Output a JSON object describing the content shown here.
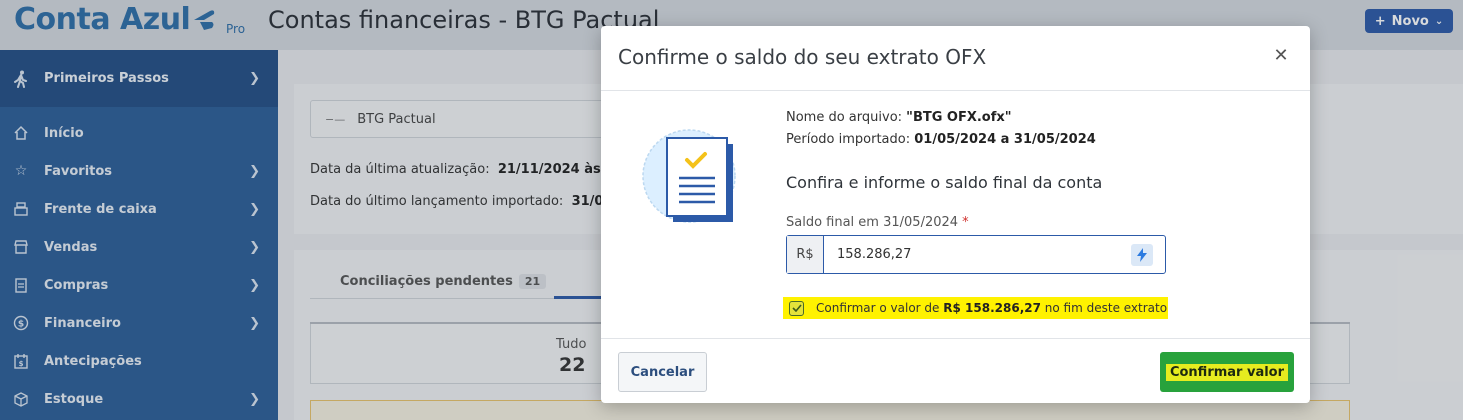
{
  "header": {
    "logo_text": "Conta Azul",
    "logo_badge": "Pro",
    "page_title": "Contas financeiras - BTG Pactual",
    "novo_label": "Novo"
  },
  "sidebar": {
    "items": [
      {
        "label": "Primeiros Passos",
        "icon": "walking-person-icon"
      },
      {
        "label": "Início",
        "icon": "home-icon"
      },
      {
        "label": "Favoritos",
        "icon": "star-icon"
      },
      {
        "label": "Frente de caixa",
        "icon": "cash-register-icon"
      },
      {
        "label": "Vendas",
        "icon": "store-icon"
      },
      {
        "label": "Compras",
        "icon": "clipboard-icon"
      },
      {
        "label": "Financeiro",
        "icon": "dollar-circle-icon"
      },
      {
        "label": "Antecipações",
        "icon": "calendar-money-icon"
      },
      {
        "label": "Estoque",
        "icon": "box-icon"
      }
    ]
  },
  "main": {
    "bank_select": "BTG Pactual",
    "last_update_label": "Data da última atualização:",
    "last_update_value": "21/11/2024 às 11",
    "last_import_label": "Data do último lançamento importado:",
    "last_import_value": "31/05/",
    "tab_pending_label": "Conciliações pendentes",
    "tab_pending_count": "21",
    "tudo_label": "Tudo",
    "tudo_value": "22"
  },
  "modal": {
    "title": "Confirme o saldo do seu extrato OFX",
    "file_label": "Nome do arquivo:",
    "file_value": "\"BTG OFX.ofx\"",
    "period_label": "Período importado:",
    "period_value": "01/05/2024 a 31/05/2024",
    "subtitle": "Confira e informe o saldo final da conta",
    "field_label": "Saldo final em 31/05/2024",
    "field_required": "*",
    "currency_prefix": "R$",
    "balance_value": "158.286,27",
    "confirm_text_prefix": "Confirmar o valor de",
    "confirm_amount": "R$ 158.286,27",
    "confirm_text_suffix": "no fim deste extrato",
    "cancel_label": "Cancelar",
    "confirm_label": "Confirmar valor"
  },
  "colors": {
    "brand_blue": "#2e6ea8",
    "sidebar_bg": "#2d5e98",
    "confirm_green": "#28a23c",
    "highlight_yellow": "#fff200"
  }
}
